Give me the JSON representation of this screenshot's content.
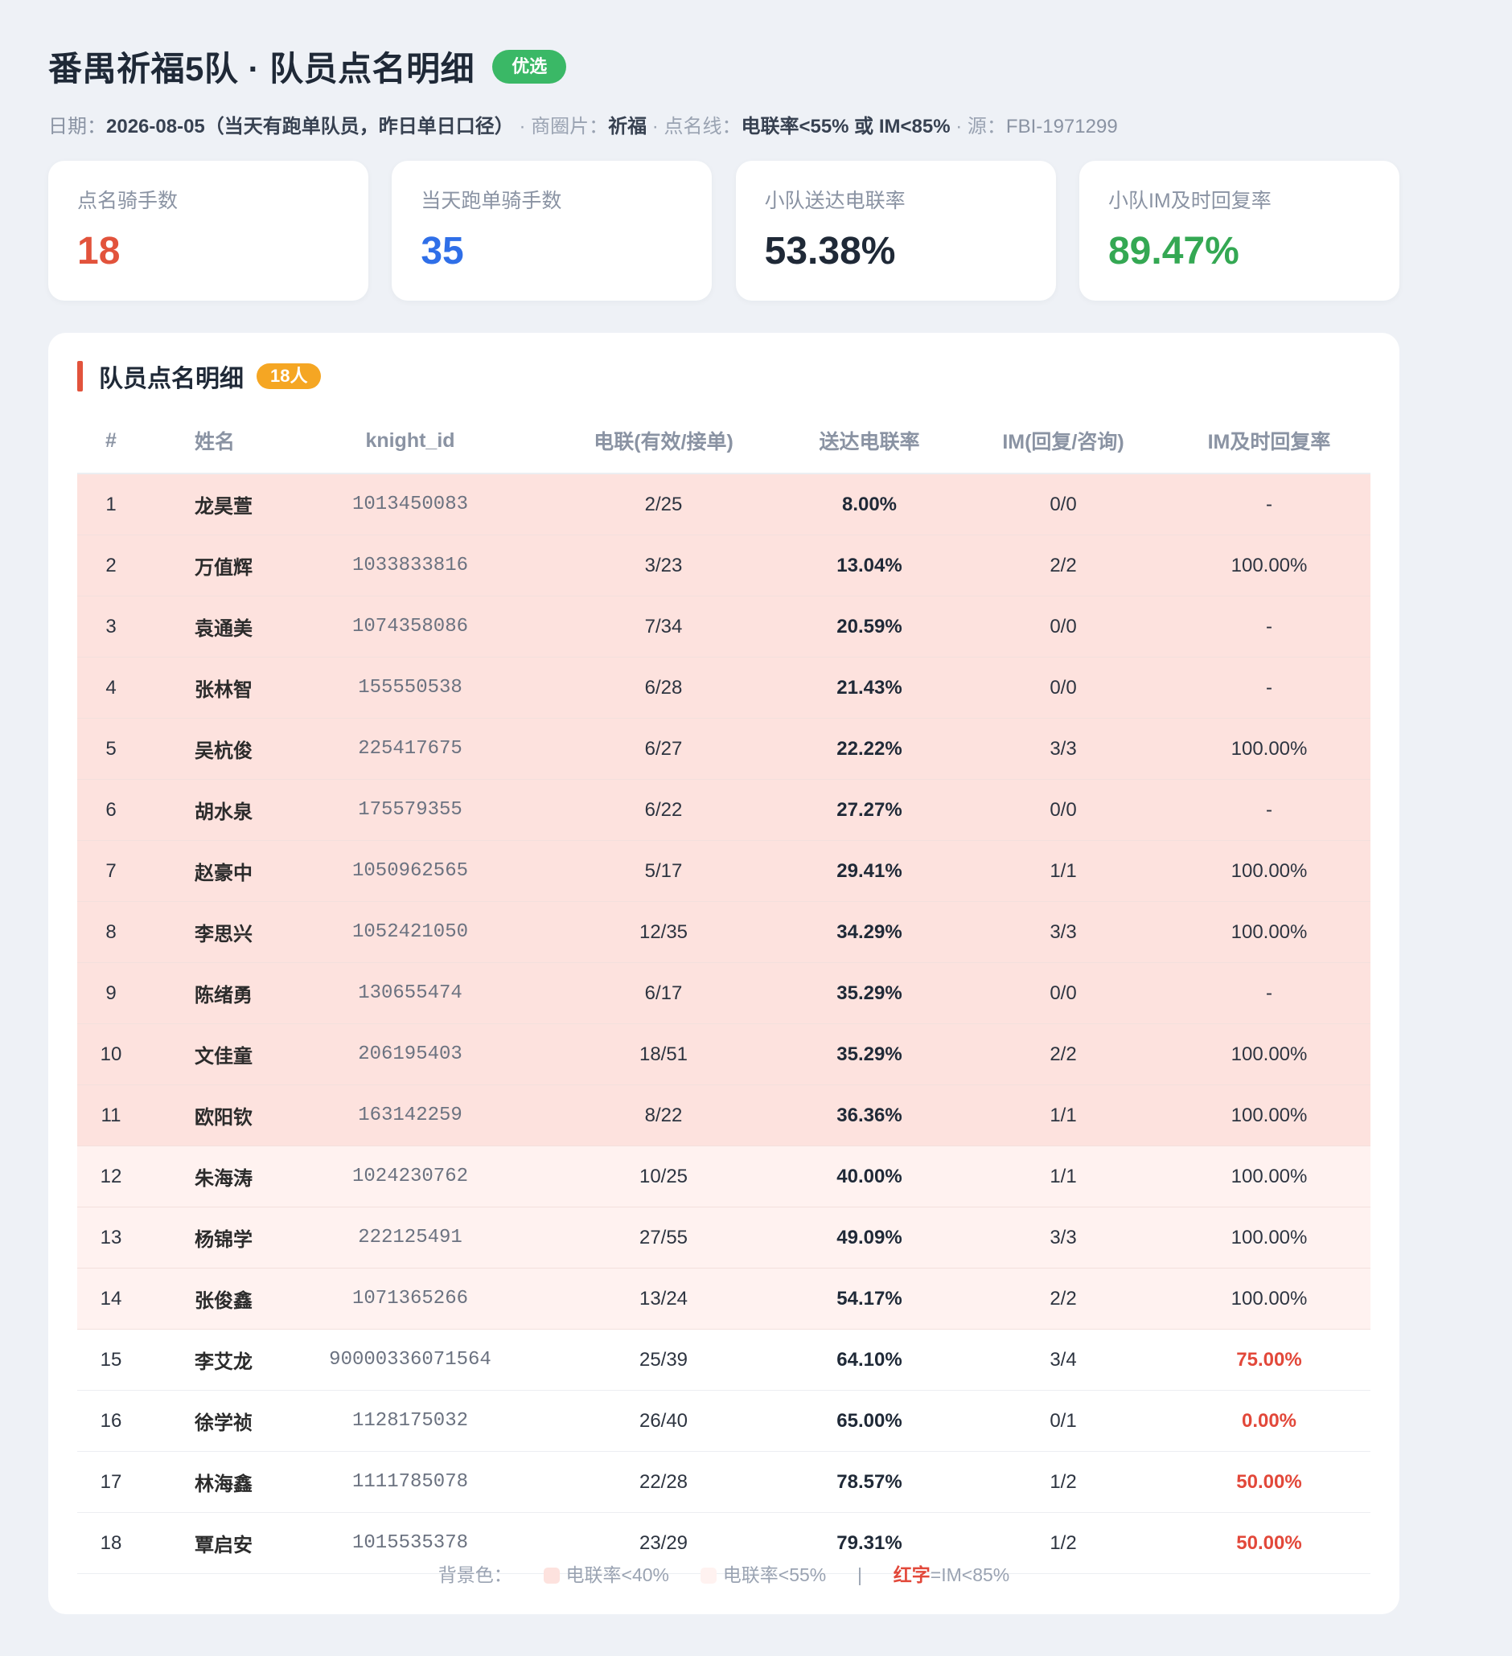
{
  "header": {
    "title": "番禺祈福5队 · 队员点名明细",
    "badge": "优选",
    "meta": {
      "date_label": "日期：",
      "date_value": "2026-08-05（当天有跑单队员，昨日单日口径）",
      "area_label": "· 商圈片：",
      "area_value": "祈福",
      "line_label": "· 点名线：",
      "line_value": "电联率<55% 或 IM<85%",
      "source_label": "· 源：",
      "source_value": "FBI-1971299"
    }
  },
  "cards": [
    {
      "label": "点名骑手数",
      "value": "18",
      "color": "#e2533c"
    },
    {
      "label": "当天跑单骑手数",
      "value": "35",
      "color": "#2f6fe8"
    },
    {
      "label": "小队送达电联率",
      "value": "53.38%",
      "color": "#1f2937"
    },
    {
      "label": "小队IM及时回复率",
      "value": "89.47%",
      "color": "#34a853"
    }
  ],
  "panel": {
    "title": "队员点名明细",
    "count_badge": "18人",
    "columns": [
      "#",
      "姓名",
      "knight_id",
      "电联(有效/接单)",
      "送达电联率",
      "IM(回复/咨询)",
      "IM及时回复率"
    ],
    "rows": [
      {
        "no": "1",
        "name": "龙昊萱",
        "id": "1013450083",
        "call": "2/25",
        "rate": "8.00%",
        "im": "0/0",
        "im_rate": "-"
      },
      {
        "no": "2",
        "name": "万值辉",
        "id": "1033833816",
        "call": "3/23",
        "rate": "13.04%",
        "im": "2/2",
        "im_rate": "100.00%"
      },
      {
        "no": "3",
        "name": "袁通美",
        "id": "1074358086",
        "call": "7/34",
        "rate": "20.59%",
        "im": "0/0",
        "im_rate": "-"
      },
      {
        "no": "4",
        "name": "张林智",
        "id": "155550538",
        "call": "6/28",
        "rate": "21.43%",
        "im": "0/0",
        "im_rate": "-"
      },
      {
        "no": "5",
        "name": "吴杭俊",
        "id": "225417675",
        "call": "6/27",
        "rate": "22.22%",
        "im": "3/3",
        "im_rate": "100.00%"
      },
      {
        "no": "6",
        "name": "胡水泉",
        "id": "175579355",
        "call": "6/22",
        "rate": "27.27%",
        "im": "0/0",
        "im_rate": "-"
      },
      {
        "no": "7",
        "name": "赵豪中",
        "id": "1050962565",
        "call": "5/17",
        "rate": "29.41%",
        "im": "1/1",
        "im_rate": "100.00%"
      },
      {
        "no": "8",
        "name": "李思兴",
        "id": "1052421050",
        "call": "12/35",
        "rate": "34.29%",
        "im": "3/3",
        "im_rate": "100.00%"
      },
      {
        "no": "9",
        "name": "陈绪勇",
        "id": "130655474",
        "call": "6/17",
        "rate": "35.29%",
        "im": "0/0",
        "im_rate": "-"
      },
      {
        "no": "10",
        "name": "文佳童",
        "id": "206195403",
        "call": "18/51",
        "rate": "35.29%",
        "im": "2/2",
        "im_rate": "100.00%"
      },
      {
        "no": "11",
        "name": "欧阳钦",
        "id": "163142259",
        "call": "8/22",
        "rate": "36.36%",
        "im": "1/1",
        "im_rate": "100.00%"
      },
      {
        "no": "12",
        "name": "朱海涛",
        "id": "1024230762",
        "call": "10/25",
        "rate": "40.00%",
        "im": "1/1",
        "im_rate": "100.00%"
      },
      {
        "no": "13",
        "name": "杨锦学",
        "id": "222125491",
        "call": "27/55",
        "rate": "49.09%",
        "im": "3/3",
        "im_rate": "100.00%"
      },
      {
        "no": "14",
        "name": "张俊鑫",
        "id": "1071365266",
        "call": "13/24",
        "rate": "54.17%",
        "im": "2/2",
        "im_rate": "100.00%"
      },
      {
        "no": "15",
        "name": "李艾龙",
        "id": "90000336071564",
        "call": "25/39",
        "rate": "64.10%",
        "im": "3/4",
        "im_rate": "75.00%"
      },
      {
        "no": "16",
        "name": "徐学祯",
        "id": "1128175032",
        "call": "26/40",
        "rate": "65.00%",
        "im": "0/1",
        "im_rate": "0.00%"
      },
      {
        "no": "17",
        "name": "林海鑫",
        "id": "1111785078",
        "call": "22/28",
        "rate": "78.57%",
        "im": "1/2",
        "im_rate": "50.00%"
      },
      {
        "no": "18",
        "name": "覃启安",
        "id": "1015535378",
        "call": "23/29",
        "rate": "79.31%",
        "im": "1/2",
        "im_rate": "50.00%"
      }
    ],
    "legend": {
      "prefix": "背景色：",
      "deep_label": "电联率<40%",
      "deep_color": "#fde2de",
      "light_label": "电联率<55%",
      "light_color": "#fff2f0",
      "divider": "|",
      "red_word": "红字",
      "red_rest": "=IM<85%"
    }
  }
}
